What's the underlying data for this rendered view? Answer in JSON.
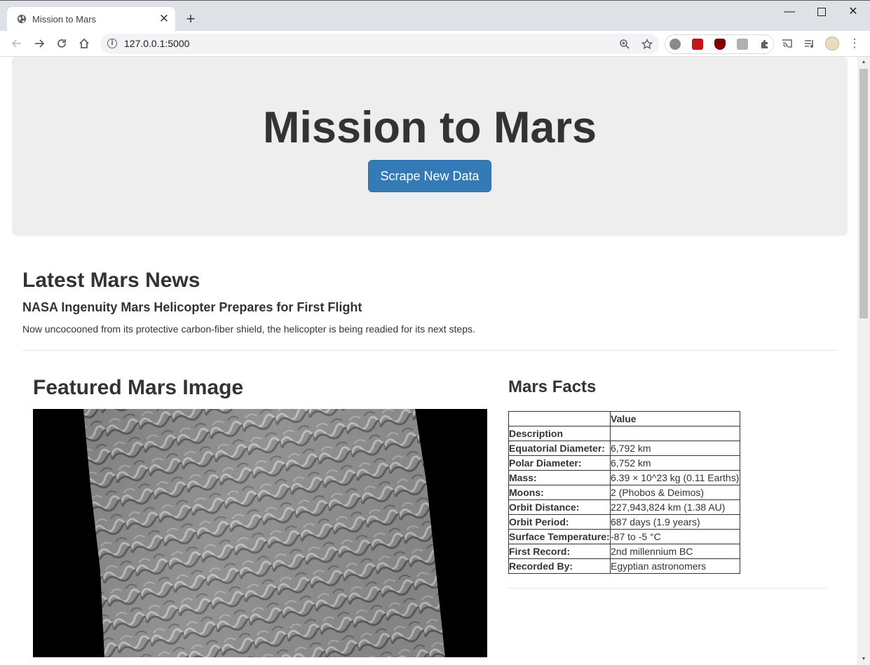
{
  "browser": {
    "tab_title": "Mission to Mars",
    "url": "127.0.0.1:5000"
  },
  "jumbotron": {
    "title": "Mission to Mars",
    "button_label": "Scrape New Data",
    "button_color": "#337ab7"
  },
  "news": {
    "heading": "Latest Mars News",
    "title": "NASA Ingenuity Mars Helicopter Prepares for First Flight",
    "teaser": "Now uncocooned from its protective carbon-fiber shield, the helicopter is being readied for its next steps."
  },
  "featured_image": {
    "heading": "Featured Mars Image"
  },
  "facts": {
    "heading": "Mars Facts",
    "header": [
      "",
      "Value"
    ],
    "index_name": "Description",
    "rows": [
      {
        "key": "Equatorial Diameter:",
        "value": "6,792 km"
      },
      {
        "key": "Polar Diameter:",
        "value": "6,752 km"
      },
      {
        "key": "Mass:",
        "value": "6.39 × 10^23 kg (0.11 Earths)"
      },
      {
        "key": "Moons:",
        "value": "2 (Phobos & Deimos)"
      },
      {
        "key": "Orbit Distance:",
        "value": "227,943,824 km (1.38 AU)"
      },
      {
        "key": "Orbit Period:",
        "value": "687 days (1.9 years)"
      },
      {
        "key": "Surface Temperature:",
        "value": "-87 to -5 °C"
      },
      {
        "key": "First Record:",
        "value": "2nd millennium BC"
      },
      {
        "key": "Recorded By:",
        "value": "Egyptian astronomers"
      }
    ]
  }
}
